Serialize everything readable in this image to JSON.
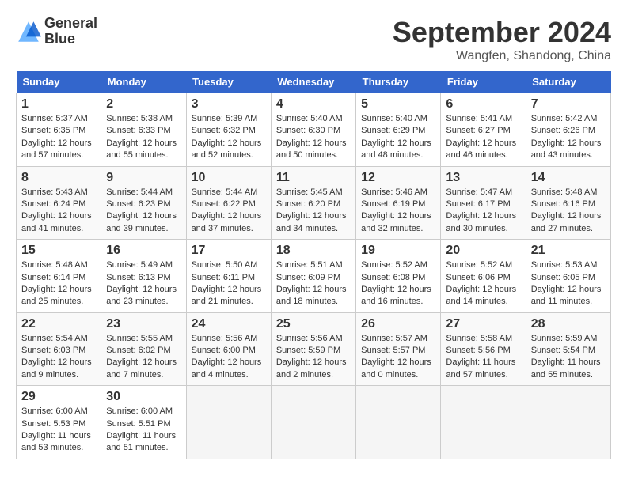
{
  "header": {
    "logo_line1": "General",
    "logo_line2": "Blue",
    "month": "September 2024",
    "location": "Wangfen, Shandong, China"
  },
  "columns": [
    "Sunday",
    "Monday",
    "Tuesday",
    "Wednesday",
    "Thursday",
    "Friday",
    "Saturday"
  ],
  "weeks": [
    [
      {
        "day": "1",
        "info": "Sunrise: 5:37 AM\nSunset: 6:35 PM\nDaylight: 12 hours\nand 57 minutes."
      },
      {
        "day": "2",
        "info": "Sunrise: 5:38 AM\nSunset: 6:33 PM\nDaylight: 12 hours\nand 55 minutes."
      },
      {
        "day": "3",
        "info": "Sunrise: 5:39 AM\nSunset: 6:32 PM\nDaylight: 12 hours\nand 52 minutes."
      },
      {
        "day": "4",
        "info": "Sunrise: 5:40 AM\nSunset: 6:30 PM\nDaylight: 12 hours\nand 50 minutes."
      },
      {
        "day": "5",
        "info": "Sunrise: 5:40 AM\nSunset: 6:29 PM\nDaylight: 12 hours\nand 48 minutes."
      },
      {
        "day": "6",
        "info": "Sunrise: 5:41 AM\nSunset: 6:27 PM\nDaylight: 12 hours\nand 46 minutes."
      },
      {
        "day": "7",
        "info": "Sunrise: 5:42 AM\nSunset: 6:26 PM\nDaylight: 12 hours\nand 43 minutes."
      }
    ],
    [
      {
        "day": "8",
        "info": "Sunrise: 5:43 AM\nSunset: 6:24 PM\nDaylight: 12 hours\nand 41 minutes."
      },
      {
        "day": "9",
        "info": "Sunrise: 5:44 AM\nSunset: 6:23 PM\nDaylight: 12 hours\nand 39 minutes."
      },
      {
        "day": "10",
        "info": "Sunrise: 5:44 AM\nSunset: 6:22 PM\nDaylight: 12 hours\nand 37 minutes."
      },
      {
        "day": "11",
        "info": "Sunrise: 5:45 AM\nSunset: 6:20 PM\nDaylight: 12 hours\nand 34 minutes."
      },
      {
        "day": "12",
        "info": "Sunrise: 5:46 AM\nSunset: 6:19 PM\nDaylight: 12 hours\nand 32 minutes."
      },
      {
        "day": "13",
        "info": "Sunrise: 5:47 AM\nSunset: 6:17 PM\nDaylight: 12 hours\nand 30 minutes."
      },
      {
        "day": "14",
        "info": "Sunrise: 5:48 AM\nSunset: 6:16 PM\nDaylight: 12 hours\nand 27 minutes."
      }
    ],
    [
      {
        "day": "15",
        "info": "Sunrise: 5:48 AM\nSunset: 6:14 PM\nDaylight: 12 hours\nand 25 minutes."
      },
      {
        "day": "16",
        "info": "Sunrise: 5:49 AM\nSunset: 6:13 PM\nDaylight: 12 hours\nand 23 minutes."
      },
      {
        "day": "17",
        "info": "Sunrise: 5:50 AM\nSunset: 6:11 PM\nDaylight: 12 hours\nand 21 minutes."
      },
      {
        "day": "18",
        "info": "Sunrise: 5:51 AM\nSunset: 6:09 PM\nDaylight: 12 hours\nand 18 minutes."
      },
      {
        "day": "19",
        "info": "Sunrise: 5:52 AM\nSunset: 6:08 PM\nDaylight: 12 hours\nand 16 minutes."
      },
      {
        "day": "20",
        "info": "Sunrise: 5:52 AM\nSunset: 6:06 PM\nDaylight: 12 hours\nand 14 minutes."
      },
      {
        "day": "21",
        "info": "Sunrise: 5:53 AM\nSunset: 6:05 PM\nDaylight: 12 hours\nand 11 minutes."
      }
    ],
    [
      {
        "day": "22",
        "info": "Sunrise: 5:54 AM\nSunset: 6:03 PM\nDaylight: 12 hours\nand 9 minutes."
      },
      {
        "day": "23",
        "info": "Sunrise: 5:55 AM\nSunset: 6:02 PM\nDaylight: 12 hours\nand 7 minutes."
      },
      {
        "day": "24",
        "info": "Sunrise: 5:56 AM\nSunset: 6:00 PM\nDaylight: 12 hours\nand 4 minutes."
      },
      {
        "day": "25",
        "info": "Sunrise: 5:56 AM\nSunset: 5:59 PM\nDaylight: 12 hours\nand 2 minutes."
      },
      {
        "day": "26",
        "info": "Sunrise: 5:57 AM\nSunset: 5:57 PM\nDaylight: 12 hours\nand 0 minutes."
      },
      {
        "day": "27",
        "info": "Sunrise: 5:58 AM\nSunset: 5:56 PM\nDaylight: 11 hours\nand 57 minutes."
      },
      {
        "day": "28",
        "info": "Sunrise: 5:59 AM\nSunset: 5:54 PM\nDaylight: 11 hours\nand 55 minutes."
      }
    ],
    [
      {
        "day": "29",
        "info": "Sunrise: 6:00 AM\nSunset: 5:53 PM\nDaylight: 11 hours\nand 53 minutes."
      },
      {
        "day": "30",
        "info": "Sunrise: 6:00 AM\nSunset: 5:51 PM\nDaylight: 11 hours\nand 51 minutes."
      },
      null,
      null,
      null,
      null,
      null
    ]
  ]
}
